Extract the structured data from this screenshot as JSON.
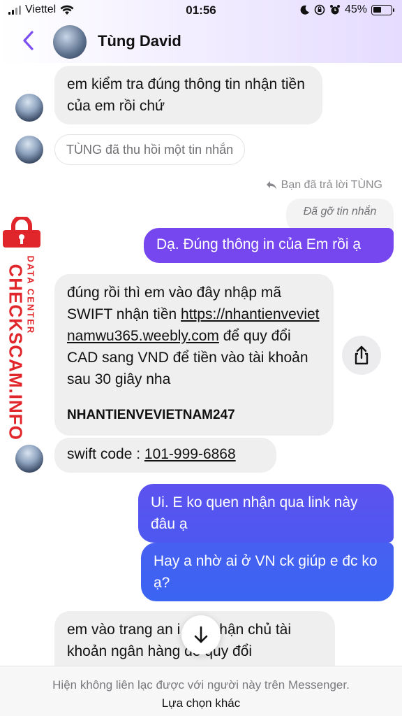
{
  "status_bar": {
    "carrier": "Viettel",
    "time": "01:56",
    "battery": "45%",
    "battery_level": 0.45,
    "icons": [
      "signal-icon",
      "wifi-icon",
      "moon-icon",
      "orientation-lock-icon",
      "alarm-icon",
      "battery-icon"
    ]
  },
  "header": {
    "contact_name": "Tùng David",
    "icons": [
      "back-chevron-icon",
      "avatar"
    ]
  },
  "messages": {
    "m1": "em kiểm tra đúng thông tin nhận tiền của em rồi chứ",
    "unsent_notice": "TÙNG đã thu hồi một tin nhắn",
    "reply_note": "Bạn đã trả lời TÙNG",
    "removed_placeholder": "Đã gỡ tin nhắn",
    "m2_out": "Dạ. Đúng thông in của Em rồi ạ",
    "m3_part1": "đúng rồi thì em vào đây nhập mã SWIFT nhận tiền ",
    "m3_link": "https://nhantienvevietnamwu365.weebly.com",
    "m3_part2": " để quy đổi CAD sang VND để tiền vào tài khoản sau 30 giây nha",
    "m3_code": "NHANTIENVEVIETNAM247",
    "m4_prefix": "swift code : ",
    "m4_code": "101-999-6868",
    "m5_out": "Ui. E ko quen nhận qua link này đâu ạ",
    "m6_out": "Hay a nhờ ai ở VN ck giúp e đc ko ạ?",
    "m7_visible": "em vào trang an  i xác nhận chủ tài khoản ngân hàng để quy đổi"
  },
  "watermark": {
    "brand": "CHECKSCAM.INFO",
    "subtitle": "DATA CENTER"
  },
  "footer": {
    "info": "Hiện không liên lạc được với người này trên Messenger.",
    "alternative": "Lựa chọn khác"
  },
  "colors": {
    "accent_purple": "#7b4ff0",
    "outgoing_top": "#7646ee",
    "outgoing_bottom": "#3a5ef2",
    "incoming_bg": "#efeff0",
    "watermark_red": "#e0262b"
  }
}
